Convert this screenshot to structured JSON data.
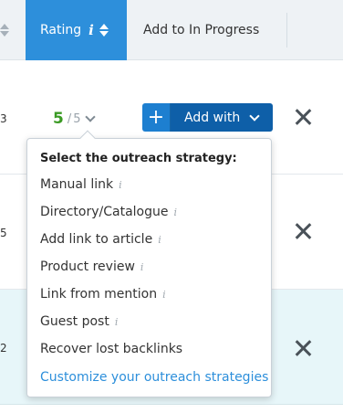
{
  "header": {
    "rating_label": "Rating",
    "info_glyph": "i",
    "progress_label": "Add to In Progress"
  },
  "rows": [
    {
      "num": "3"
    },
    {
      "num": "5"
    },
    {
      "num": "2"
    }
  ],
  "rating": {
    "score": "5",
    "separator": "/",
    "max": "5"
  },
  "add_button": {
    "plus": "+",
    "label": "Add with"
  },
  "dropdown": {
    "title": "Select the outreach strategy:",
    "items": [
      {
        "label": "Manual link",
        "info": "i"
      },
      {
        "label": "Directory/Catalogue",
        "info": "i"
      },
      {
        "label": "Add link to article",
        "info": "i"
      },
      {
        "label": "Product review",
        "info": "i"
      },
      {
        "label": "Link from mention",
        "info": "i"
      },
      {
        "label": "Guest post",
        "info": "i"
      },
      {
        "label": "Recover lost backlinks",
        "info": ""
      }
    ],
    "customize_link": "Customize your outreach strategies"
  },
  "colors": {
    "accent": "#2d8fdb",
    "button_dark": "#0e5fa8",
    "score_green": "#3a9a23",
    "highlight_row": "#e7f6f9"
  }
}
